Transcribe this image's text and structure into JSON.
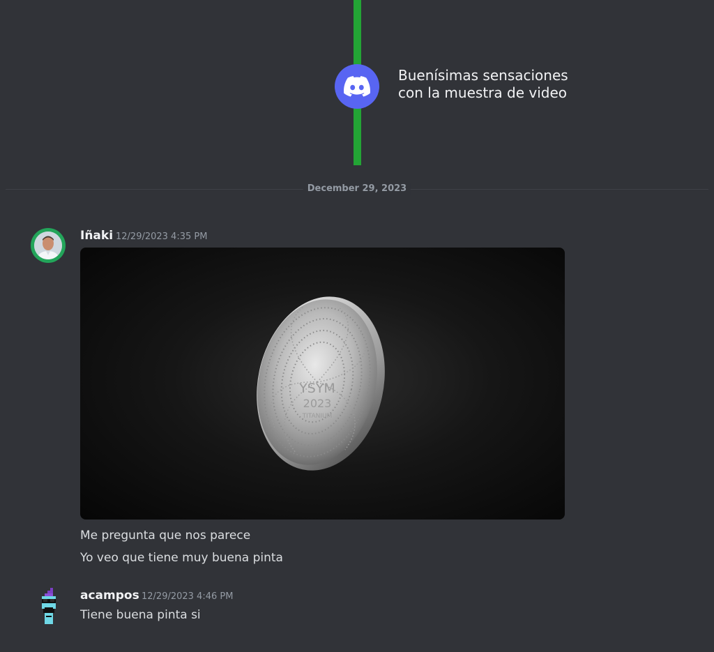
{
  "timeline": {
    "caption_line1": "Buenísimas sensaciones",
    "caption_line2": "con la muestra de video",
    "line_color": "#23a535",
    "badge_color": "#5865f2",
    "badge_icon": "discord-logo-icon"
  },
  "divider": {
    "date": "December 29, 2023"
  },
  "messages": [
    {
      "author": "Iñaki",
      "timestamp": "12/29/2023 4:35 PM",
      "avatar": "avatar-photo",
      "attachment": {
        "type": "image",
        "coin_text_line1": "YSYM",
        "coin_text_line2": "2023",
        "coin_text_line3": "TITANIUM"
      },
      "lines": [
        "Me pregunta que nos parece",
        "Yo veo que tiene muy buena pinta"
      ]
    },
    {
      "author": "acampos",
      "timestamp": "12/29/2023 4:46 PM",
      "avatar": "pixel-art-avatar",
      "lines": [
        "Tiene buena pinta si"
      ]
    }
  ]
}
